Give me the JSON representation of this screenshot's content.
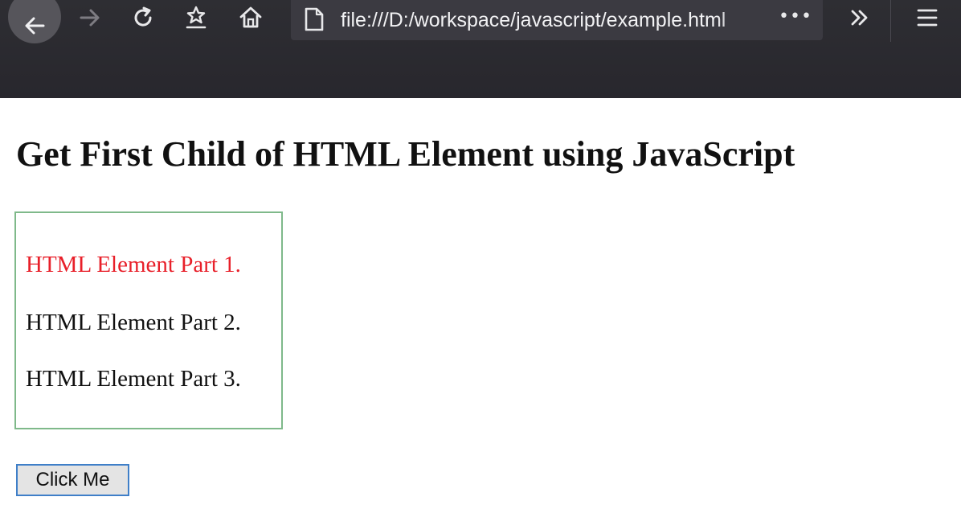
{
  "browser": {
    "url": "file:///D:/workspace/javascript/example.html",
    "more_label": "•••"
  },
  "colors": {
    "toolbar_bg": "#2b2a33",
    "highlight_text": "#e8202a",
    "container_border": "#7fb98a",
    "button_border": "#3f7fc8"
  },
  "icons": {
    "back": "arrow-left-icon",
    "forward": "arrow-right-icon",
    "reload": "reload-icon",
    "bookmark": "bookmark-star-icon",
    "home": "home-icon",
    "page": "page-icon",
    "overflow": "chevron-double-right-icon",
    "menu": "hamburger-menu-icon"
  },
  "page": {
    "heading": "Get First Child of HTML Element using JavaScript",
    "parts": [
      "HTML Element Part 1.",
      "HTML Element Part 2.",
      "HTML Element Part 3."
    ],
    "button_label": "Click Me"
  }
}
